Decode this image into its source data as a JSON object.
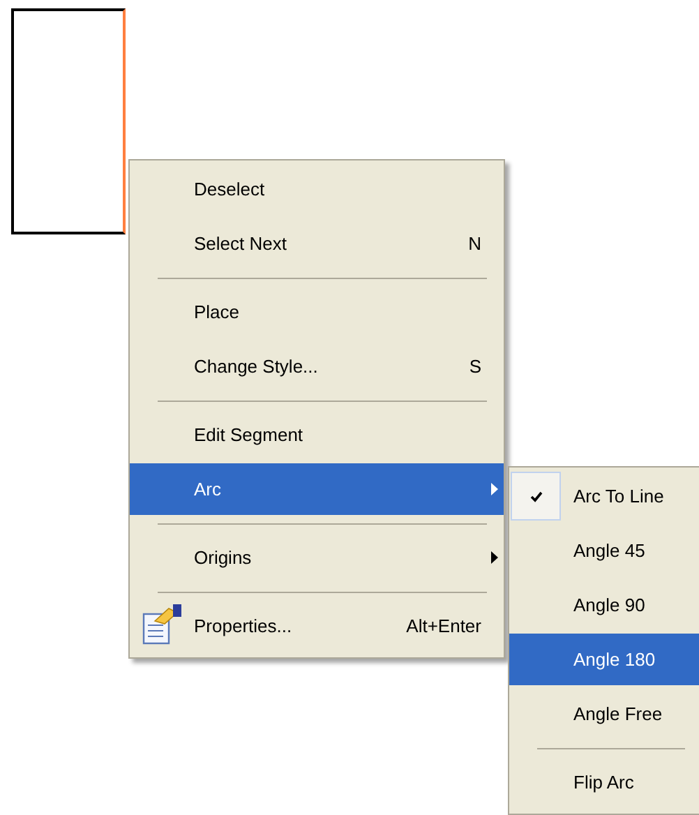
{
  "canvas": {
    "shape": {
      "kind": "rectangle",
      "selected": true
    }
  },
  "context_menu": {
    "items": [
      {
        "kind": "item",
        "label": "Deselect",
        "selected": false,
        "submenu": false,
        "icon": false
      },
      {
        "kind": "item",
        "label": "Select Next",
        "shortcut": "N",
        "selected": false,
        "submenu": false,
        "icon": false
      },
      {
        "kind": "separator"
      },
      {
        "kind": "item",
        "label": "Place",
        "selected": false,
        "submenu": false,
        "icon": false
      },
      {
        "kind": "item",
        "label": "Change Style...",
        "shortcut": "S",
        "selected": false,
        "submenu": false,
        "icon": false
      },
      {
        "kind": "separator"
      },
      {
        "kind": "item",
        "label": "Edit Segment",
        "selected": false,
        "submenu": false,
        "icon": false
      },
      {
        "kind": "item",
        "label": "Arc",
        "selected": true,
        "submenu": true,
        "icon": false
      },
      {
        "kind": "separator"
      },
      {
        "kind": "item",
        "label": "Origins",
        "selected": false,
        "submenu": true,
        "icon": false
      },
      {
        "kind": "separator"
      },
      {
        "kind": "item",
        "label": "Properties...",
        "shortcut": "Alt+Enter",
        "selected": false,
        "submenu": false,
        "icon": true
      }
    ]
  },
  "submenu": {
    "items": [
      {
        "kind": "item",
        "label": "Arc To Line",
        "checked": true,
        "selected": false
      },
      {
        "kind": "item",
        "label": "Angle 45",
        "checked": false,
        "selected": false
      },
      {
        "kind": "item",
        "label": "Angle 90",
        "checked": false,
        "selected": false
      },
      {
        "kind": "item",
        "label": "Angle 180",
        "checked": false,
        "selected": true
      },
      {
        "kind": "item",
        "label": "Angle Free",
        "checked": false,
        "selected": false
      },
      {
        "kind": "separator"
      },
      {
        "kind": "item",
        "label": "Flip Arc",
        "checked": false,
        "selected": false
      }
    ]
  }
}
